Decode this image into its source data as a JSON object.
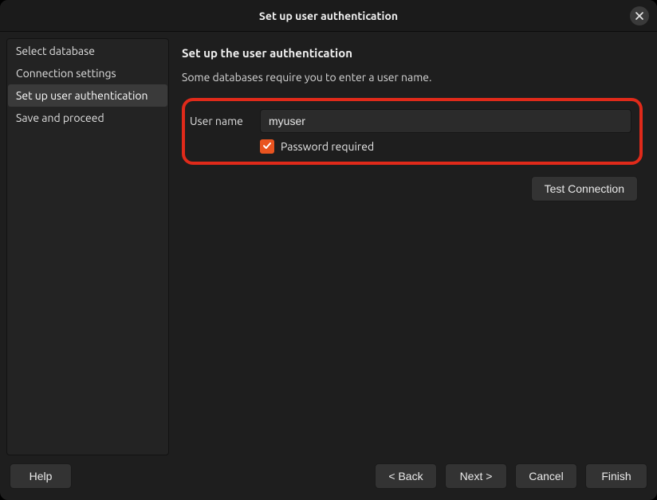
{
  "window": {
    "title": "Set up user authentication"
  },
  "sidebar": {
    "items": [
      {
        "label": "Select database",
        "active": false
      },
      {
        "label": "Connection settings",
        "active": false
      },
      {
        "label": "Set up user authentication",
        "active": true
      },
      {
        "label": "Save and proceed",
        "active": false
      }
    ]
  },
  "main": {
    "heading": "Set up the user authentication",
    "subtext": "Some databases require you to enter a user name.",
    "username_label": "User name",
    "username_value": "myuser",
    "password_required_label": "Password required",
    "password_required_checked": true,
    "test_connection_label": "Test Connection"
  },
  "footer": {
    "help": "Help",
    "back": "< Back",
    "next": "Next >",
    "cancel": "Cancel",
    "finish": "Finish"
  },
  "colors": {
    "accent": "#e95420",
    "highlight_border": "#e02a1a"
  }
}
